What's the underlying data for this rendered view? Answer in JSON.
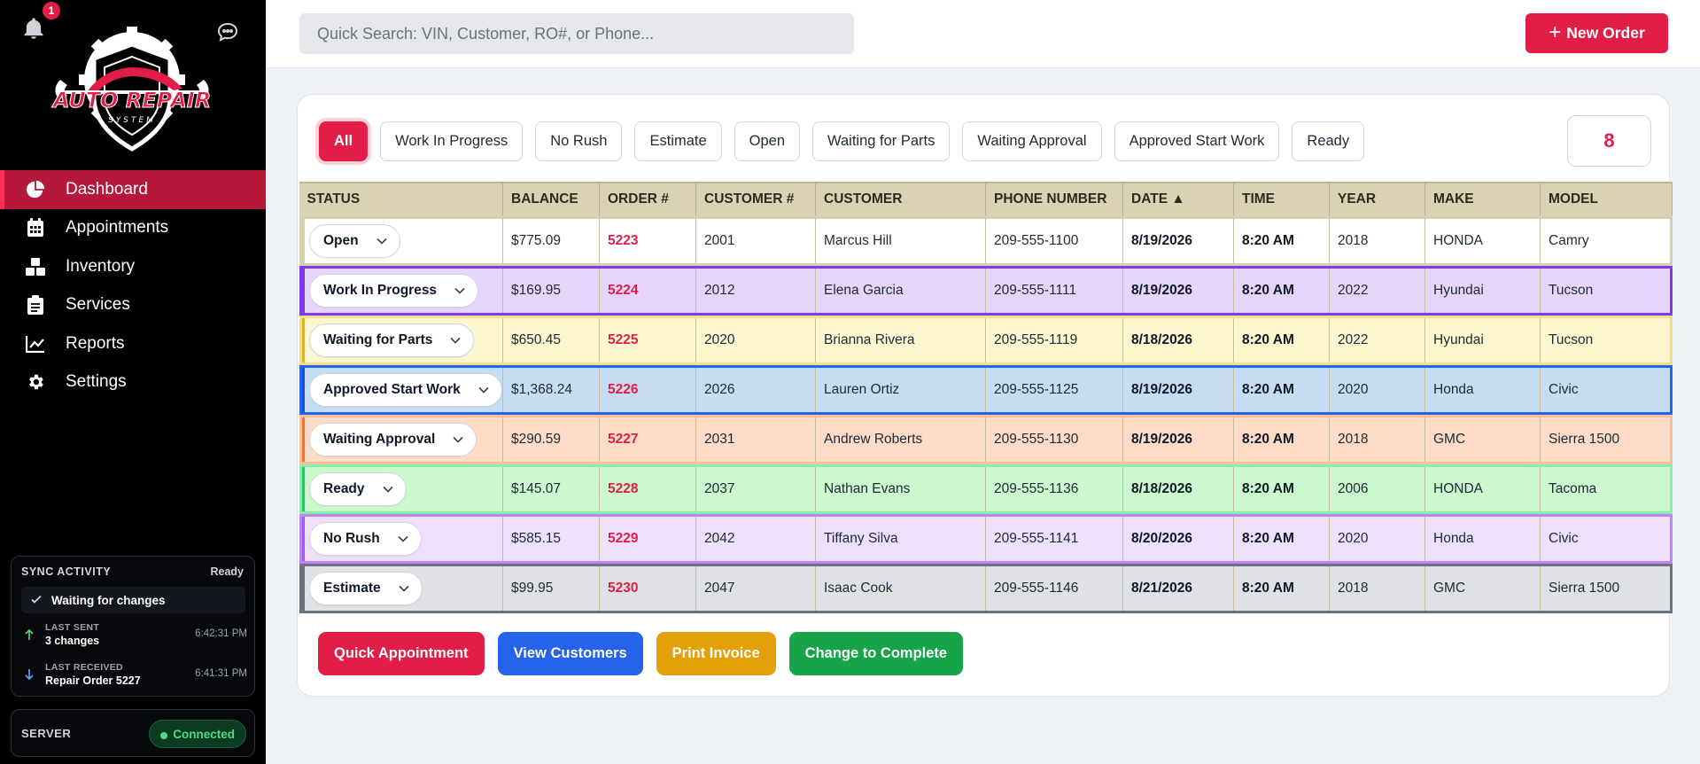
{
  "notifications": {
    "count": "1"
  },
  "logo": {
    "text": "AUTO REPAIR",
    "subtext": "SYSTEM"
  },
  "sidebar": {
    "items": [
      {
        "label": "Dashboard",
        "icon": "pie-chart-icon",
        "active": true
      },
      {
        "label": "Appointments",
        "icon": "calendar-icon",
        "active": false
      },
      {
        "label": "Inventory",
        "icon": "boxes-icon",
        "active": false
      },
      {
        "label": "Services",
        "icon": "clipboard-icon",
        "active": false
      },
      {
        "label": "Reports",
        "icon": "line-chart-icon",
        "active": false
      },
      {
        "label": "Settings",
        "icon": "gear-icon",
        "active": false
      }
    ]
  },
  "sync": {
    "title": "SYNC ACTIVITY",
    "status": "Ready",
    "waiting": "Waiting for changes",
    "last_sent_label": "LAST SENT",
    "last_sent_value": "3 changes",
    "last_sent_time": "6:42:31 PM",
    "last_received_label": "LAST RECEIVED",
    "last_received_value": "Repair Order 5227",
    "last_received_time": "6:41:31 PM"
  },
  "server": {
    "label": "SERVER",
    "status": "Connected"
  },
  "search": {
    "placeholder": "Quick Search: VIN, Customer, RO#, or Phone..."
  },
  "toolbar": {
    "new_order": "New Order"
  },
  "filters": [
    "All",
    "Work In Progress",
    "No Rush",
    "Estimate",
    "Open",
    "Waiting for Parts",
    "Waiting Approval",
    "Approved Start Work",
    "Ready"
  ],
  "active_filter": "All",
  "order_count": "8",
  "table": {
    "headers": [
      "STATUS",
      "BALANCE",
      "ORDER #",
      "CUSTOMER #",
      "CUSTOMER",
      "PHONE NUMBER",
      "DATE ▲",
      "TIME",
      "YEAR",
      "MAKE",
      "MODEL"
    ],
    "rows": [
      {
        "status": "Open",
        "balance": "$775.09",
        "order": "5223",
        "customer_no": "2001",
        "customer": "Marcus Hill",
        "phone": "209-555-1100",
        "date": "8/19/2026",
        "time": "8:20 AM",
        "year": "2018",
        "make": "HONDA",
        "model": "Camry",
        "bg": "#ffffff",
        "border": "#d6cfb0",
        "accent": "#d6cfb0"
      },
      {
        "status": "Work In Progress",
        "balance": "$169.95",
        "order": "5224",
        "customer_no": "2012",
        "customer": "Elena Garcia",
        "phone": "209-555-1111",
        "date": "8/19/2026",
        "time": "8:20 AM",
        "year": "2022",
        "make": "Hyundai",
        "model": "Tucson",
        "bg": "#e5d5fa",
        "border": "#7c3aed",
        "accent": "#7c3aed"
      },
      {
        "status": "Waiting for Parts",
        "balance": "$650.45",
        "order": "5225",
        "customer_no": "2020",
        "customer": "Brianna Rivera",
        "phone": "209-555-1119",
        "date": "8/18/2026",
        "time": "8:20 AM",
        "year": "2022",
        "make": "Hyundai",
        "model": "Tucson",
        "bg": "#fdf7cf",
        "border": "#efe089",
        "accent": "#eab308"
      },
      {
        "status": "Approved Start Work",
        "balance": "$1,368.24",
        "order": "5226",
        "customer_no": "2026",
        "customer": "Lauren Ortiz",
        "phone": "209-555-1125",
        "date": "8/19/2026",
        "time": "8:20 AM",
        "year": "2020",
        "make": "Honda",
        "model": "Civic",
        "bg": "#c6dcf2",
        "border": "#2563eb",
        "accent": "#1d4ed8"
      },
      {
        "status": "Waiting Approval",
        "balance": "$290.59",
        "order": "5227",
        "customer_no": "2031",
        "customer": "Andrew Roberts",
        "phone": "209-555-1130",
        "date": "8/19/2026",
        "time": "8:20 AM",
        "year": "2018",
        "make": "GMC",
        "model": "Sierra 1500",
        "bg": "#fcdcc6",
        "border": "#fbbf9a",
        "accent": "#f97316"
      },
      {
        "status": "Ready",
        "balance": "$145.07",
        "order": "5228",
        "customer_no": "2037",
        "customer": "Nathan Evans",
        "phone": "209-555-1136",
        "date": "8/18/2026",
        "time": "8:20 AM",
        "year": "2006",
        "make": "HONDA",
        "model": "Tacoma",
        "bg": "#cbf8cd",
        "border": "#86efac",
        "accent": "#22c55e"
      },
      {
        "status": "No Rush",
        "balance": "$585.15",
        "order": "5229",
        "customer_no": "2042",
        "customer": "Tiffany Silva",
        "phone": "209-555-1141",
        "date": "8/20/2026",
        "time": "8:20 AM",
        "year": "2020",
        "make": "Honda",
        "model": "Civic",
        "bg": "#eee0fb",
        "border": "#c084fc",
        "accent": "#a855f7"
      },
      {
        "status": "Estimate",
        "balance": "$99.95",
        "order": "5230",
        "customer_no": "2047",
        "customer": "Isaac Cook",
        "phone": "209-555-1146",
        "date": "8/21/2026",
        "time": "8:20 AM",
        "year": "2018",
        "make": "GMC",
        "model": "Sierra 1500",
        "bg": "#dfe1e4",
        "border": "#6b7280",
        "accent": "#6b7280"
      }
    ]
  },
  "actions": [
    {
      "label": "Quick Appointment",
      "color": "#e11d48"
    },
    {
      "label": "View Customers",
      "color": "#2563eb"
    },
    {
      "label": "Print Invoice",
      "color": "#e3a008"
    },
    {
      "label": "Change to Complete",
      "color": "#16a34a"
    }
  ]
}
